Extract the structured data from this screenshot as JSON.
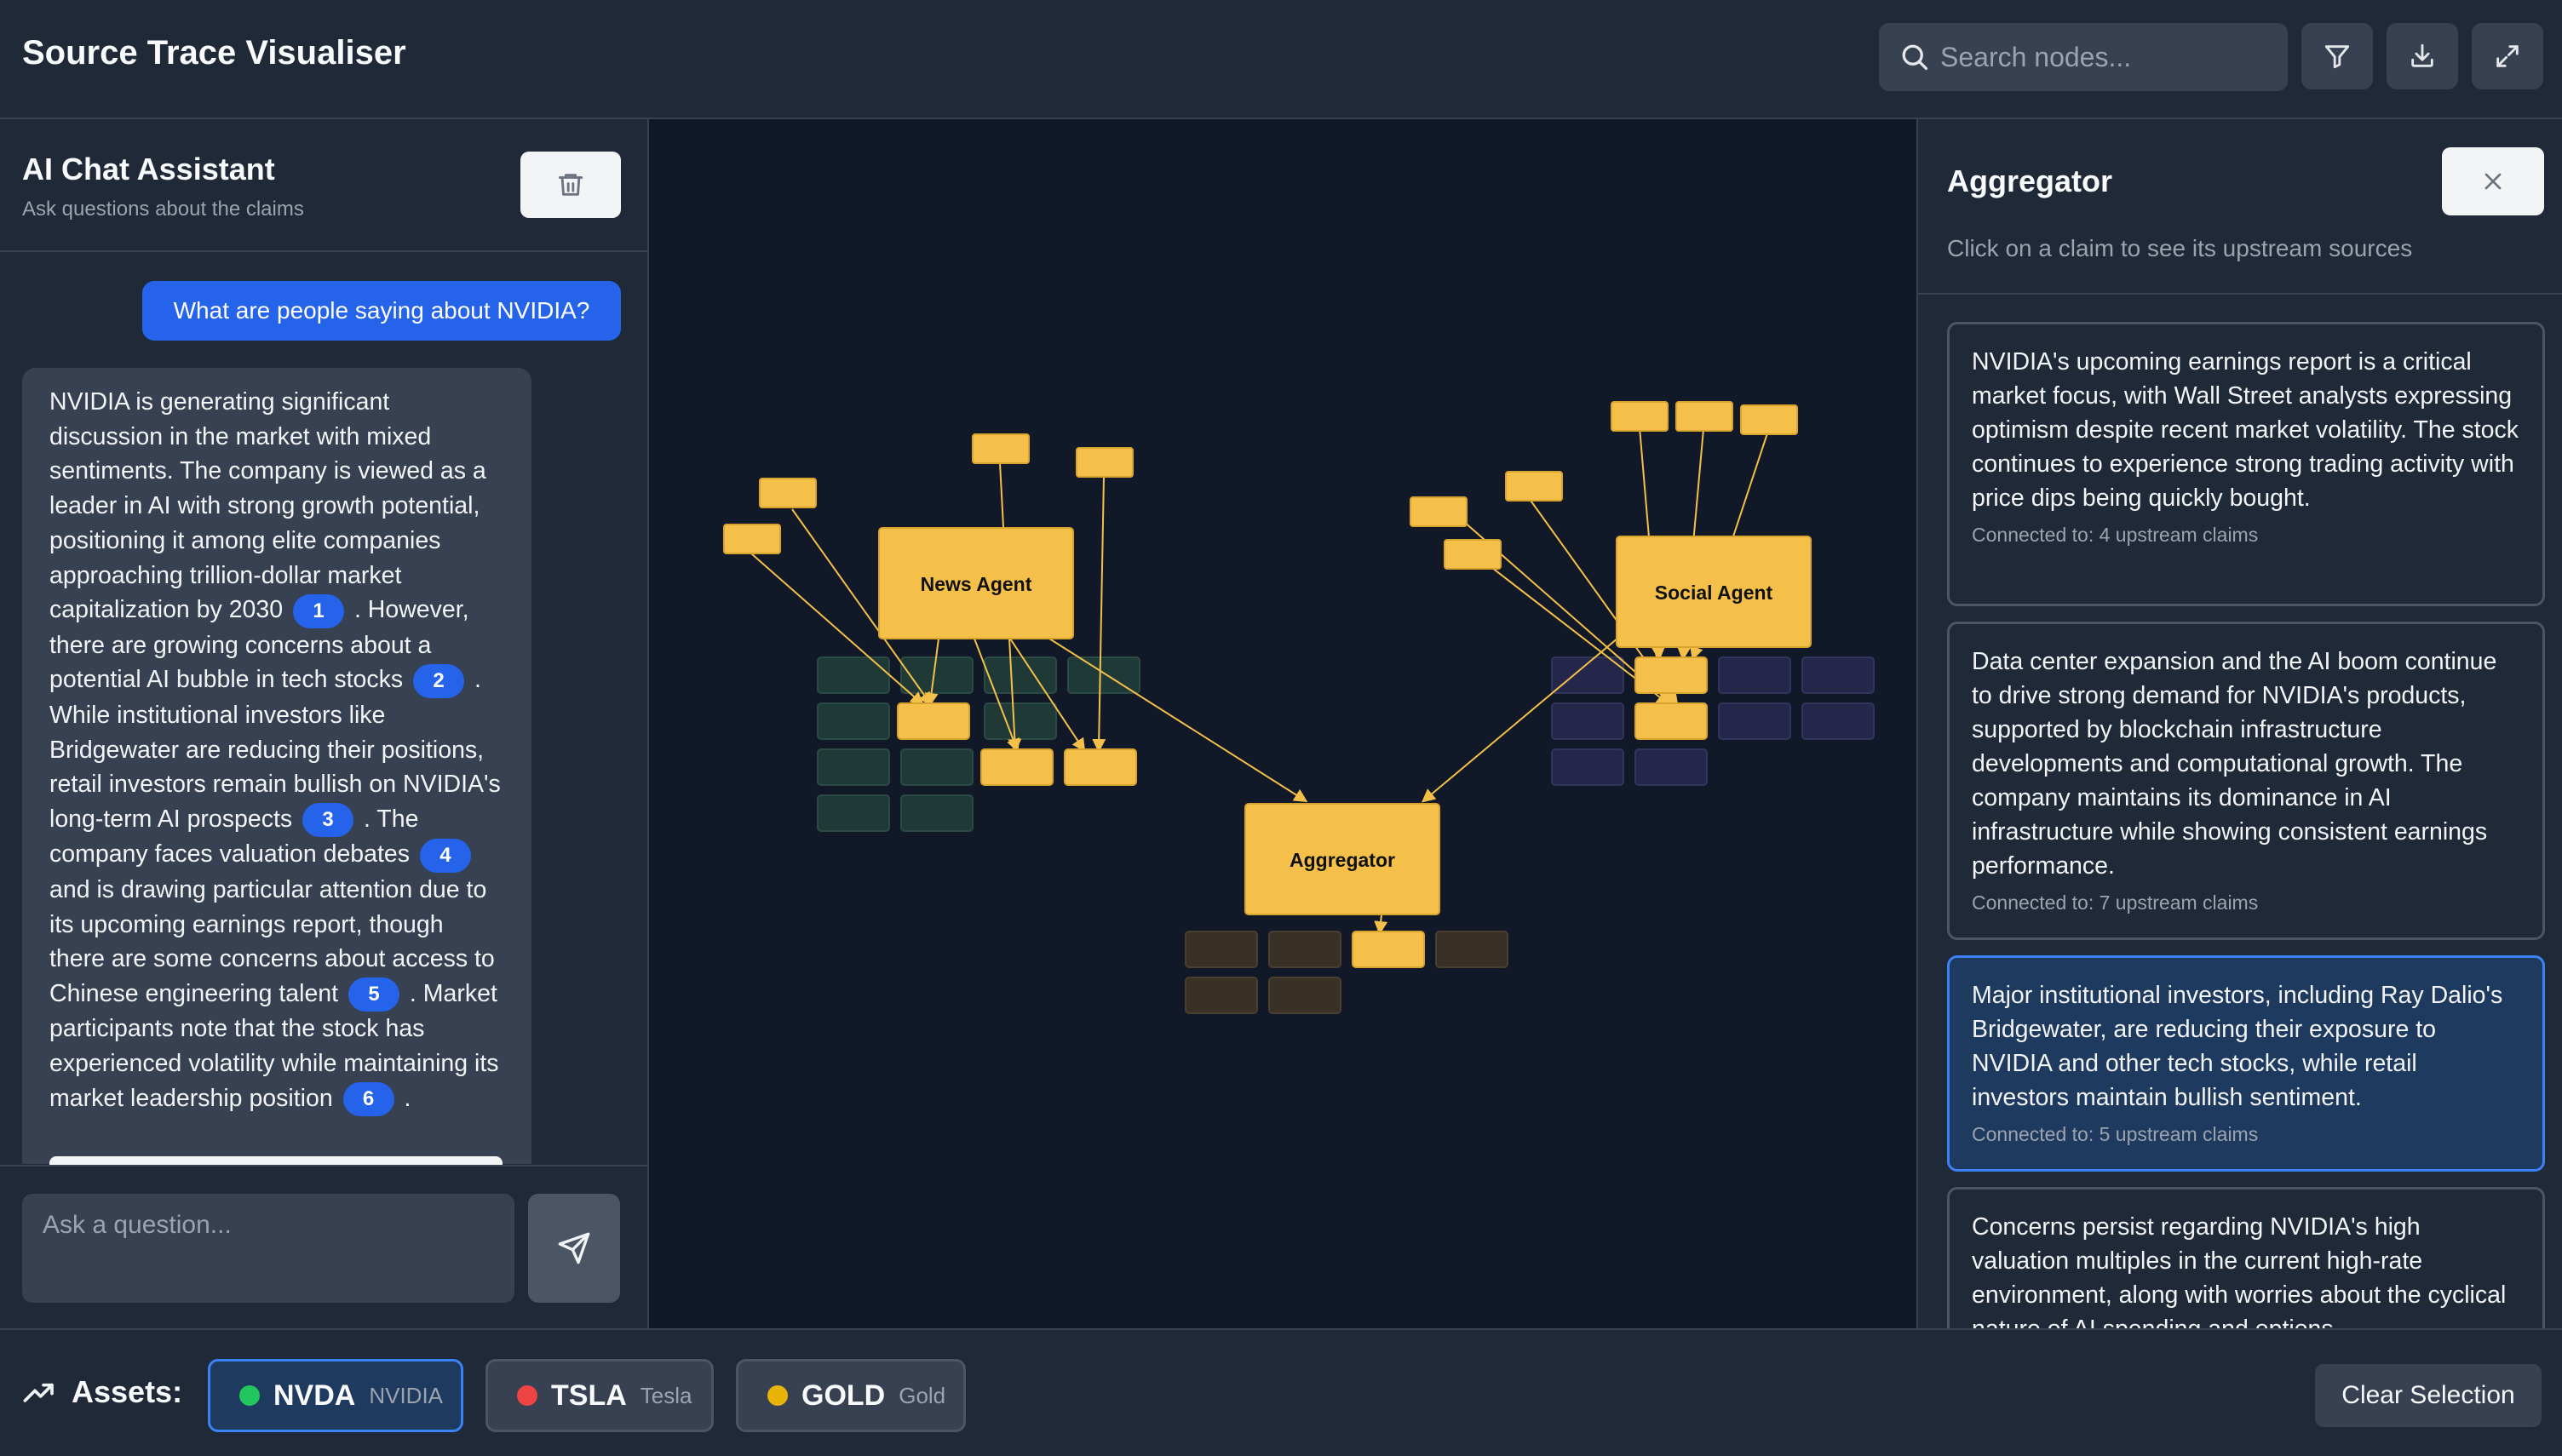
{
  "header": {
    "title": "Source Trace Visualiser",
    "search_placeholder": "Search nodes...",
    "buttons": [
      "filter-icon",
      "download-icon",
      "expand-icon"
    ]
  },
  "chat": {
    "title": "AI Chat Assistant",
    "subtitle": "Ask questions about the claims",
    "user_message": "What are people saying about NVIDIA?",
    "assistant_segments": [
      {
        "text": "NVIDIA is generating significant discussion in the market with mixed sentiments. The company is viewed as a leader in AI with strong growth potential, positioning it among elite companies approaching trillion-dollar market capitalization by 2030"
      },
      {
        "cite": "1"
      },
      {
        "text": ". However, there are growing concerns about a potential AI bubble in tech stocks"
      },
      {
        "cite": "2"
      },
      {
        "text": ". While institutional investors like Bridgewater are reducing their positions, retail investors remain bullish on NVIDIA's long-term AI prospects"
      },
      {
        "cite": "3"
      },
      {
        "text": ". The company faces valuation debates"
      },
      {
        "cite": "4"
      },
      {
        "text": "and is drawing particular attention due to its upcoming earnings report, though there are some concerns about access to Chinese engineering talent"
      },
      {
        "cite": "5"
      },
      {
        "text": ". Market participants note that the stock has experienced volatility while maintaining its market leadership position"
      },
      {
        "cite": "6"
      },
      {
        "text": "."
      }
    ],
    "input_placeholder": "Ask a question..."
  },
  "graph": {
    "agents": [
      {
        "name": "News Agent"
      },
      {
        "name": "Social Agent"
      },
      {
        "name": "Aggregator"
      }
    ]
  },
  "detail": {
    "title": "Aggregator",
    "subtitle": "Click on a claim to see its upstream sources",
    "claims": [
      {
        "text": "NVIDIA's upcoming earnings report is a critical market focus, with Wall Street analysts expressing optimism despite recent market volatility. The stock continues to experience strong trading activity with price dips being quickly bought.",
        "connected": "Connected to: 4 upstream claims",
        "selected": false
      },
      {
        "text": "Data center expansion and the AI boom continue to drive strong demand for NVIDIA's products, supported by blockchain infrastructure developments and computational growth. The company maintains its dominance in AI infrastructure while showing consistent earnings performance.",
        "connected": "Connected to: 7 upstream claims",
        "selected": false
      },
      {
        "text": "Major institutional investors, including Ray Dalio's Bridgewater, are reducing their exposure to NVIDIA and other tech stocks, while retail investors maintain bullish sentiment.",
        "connected": "Connected to: 5 upstream claims",
        "selected": true
      },
      {
        "text": "Concerns persist regarding NVIDIA's high valuation multiples in the current high-rate environment, along with worries about the cyclical nature of AI spending and options",
        "connected": "",
        "selected": false
      }
    ]
  },
  "footer": {
    "assets_label": "Assets:",
    "assets": [
      {
        "ticker": "NVDA",
        "name": "NVIDIA",
        "color": "#22c55e",
        "active": true
      },
      {
        "ticker": "TSLA",
        "name": "Tesla",
        "color": "#ef4444",
        "active": false
      },
      {
        "ticker": "GOLD",
        "name": "Gold",
        "color": "#eab308",
        "active": false
      }
    ],
    "clear_label": "Clear Selection"
  },
  "colors": {
    "accent": "#2563eb",
    "node": "#f4c04a",
    "background": "#111827",
    "panel": "#1f2937"
  }
}
